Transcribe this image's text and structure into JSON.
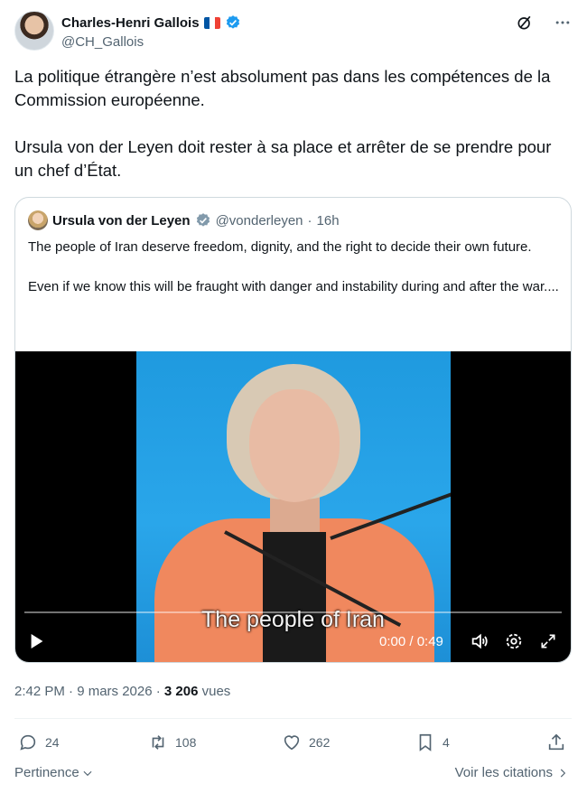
{
  "tweet": {
    "author_name": "Charles-Henri Gallois",
    "author_flag": "🇫🇷",
    "author_handle": "@CH_Gallois",
    "text": "La politique étrangère n’est absolument pas dans les compétences de la Commission européenne.\n\nUrsula von der Leyen doit rester à sa place et arrêter de se prendre pour un chef d’État.",
    "top_icons": [
      "grok-icon",
      "more-icon"
    ]
  },
  "quote": {
    "author_name": "Ursula von der Leyen",
    "author_handle": "@vonderleyen",
    "time": "16h",
    "separator": "·",
    "text": "The people of Iran deserve freedom, dignity, and the right to decide their own future.\n\nEven if we know this will be fraught with danger and instability during and after the war....",
    "video": {
      "subtitle": "The people of Iran",
      "time": "0:00 / 0:49"
    }
  },
  "meta": {
    "time_date": "2:42 PM · 9 mars 2026 · ",
    "views_count": "3 206",
    "views_label": " vues"
  },
  "actions": {
    "replies": "24",
    "reposts": "108",
    "likes": "262",
    "bookmarks": "4"
  },
  "footer": {
    "sort_label": "Pertinence",
    "quotes_label": "Voir les citations"
  },
  "colors": {
    "accent": "#1d9bf0",
    "muted": "#536471",
    "text": "#0f1419",
    "border": "#cfd9de"
  }
}
